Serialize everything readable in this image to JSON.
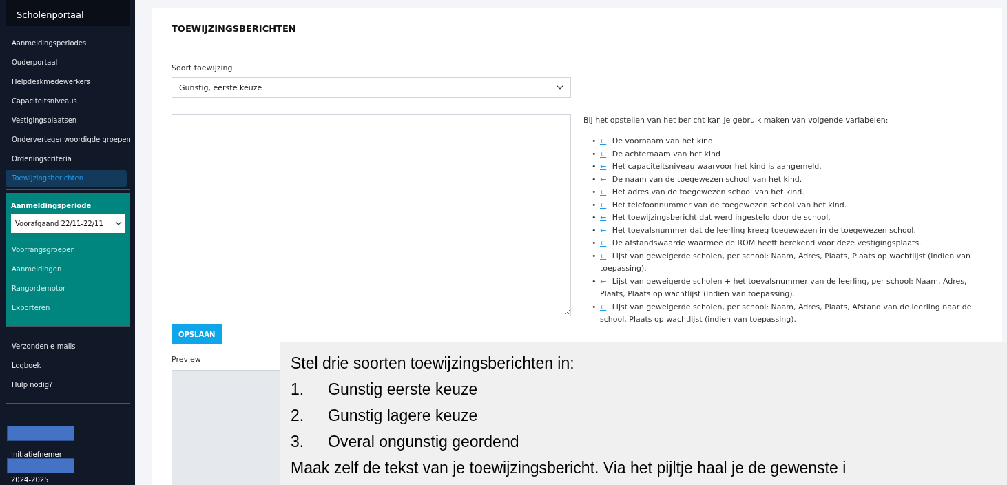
{
  "sidebar": {
    "title": "Scholenportaal",
    "nav": [
      {
        "label": "Aanmeldingsperiodes",
        "selected": false
      },
      {
        "label": "Ouderportaal",
        "selected": false
      },
      {
        "label": "Helpdeskmedewerkers",
        "selected": false
      },
      {
        "label": "Capaciteitsniveaus",
        "selected": false
      },
      {
        "label": "Vestigingsplaatsen",
        "selected": false
      },
      {
        "label": "Ondervertegenwoordigde groepen",
        "selected": false
      },
      {
        "label": "Ordeningscriteria",
        "selected": false
      },
      {
        "label": "Toewijzingsberichten",
        "selected": true
      }
    ],
    "period": {
      "label": "Aanmeldingsperiode",
      "value": "Voorafgaand 22/11-22/11",
      "items": [
        {
          "label": "Voorrangsgroepen",
          "selected": false
        },
        {
          "label": "Aanmeldingen",
          "selected": false
        },
        {
          "label": "Rangordemotor",
          "selected": false
        },
        {
          "label": "Exporteren",
          "selected": false
        }
      ]
    },
    "extra": [
      {
        "label": "Verzonden e-mails",
        "selected": false
      },
      {
        "label": "Logboek",
        "selected": false
      },
      {
        "label": "Hulp nodig?",
        "selected": false
      }
    ],
    "profile": {
      "role": "Initiatiefnemer",
      "year": "2024-2025"
    }
  },
  "card": {
    "title": "TOEWIJZINGSBERICHTEN",
    "type_label": "Soort toewijzing",
    "type_value": "Gunstig, eerste keuze",
    "help_intro": "Bij het opstellen van het bericht kan je gebruik maken van volgende variabelen:",
    "variables": [
      {
        "bullet": "•",
        "insert": "←",
        "text": "De voornaam van het kind"
      },
      {
        "bullet": "•",
        "insert": "←",
        "text": "De achternaam van het kind"
      },
      {
        "bullet": "•",
        "insert": "←",
        "text": "Het capaciteitsniveau waarvoor het kind is aangemeld."
      },
      {
        "bullet": "•",
        "insert": "←",
        "text": "De naam van de toegewezen school van het kind."
      },
      {
        "bullet": "•",
        "insert": "←",
        "text": "Het adres van de toegewezen school van het kind."
      },
      {
        "bullet": "•",
        "insert": "←",
        "text": "Het telefoonnummer van de toegewezen school van het kind."
      },
      {
        "bullet": "•",
        "insert": "←",
        "text": "Het toewijzingsbericht dat werd ingesteld door de school."
      },
      {
        "bullet": "•",
        "insert": "←",
        "text": "Het toevalsnummer dat de leerling kreeg toegewezen in de toegewezen school."
      },
      {
        "bullet": "•",
        "insert": "←",
        "text": "De afstandswaarde waarmee de ROM heeft berekend voor deze vestigingsplaats."
      },
      {
        "bullet": "•",
        "insert": "←",
        "text": "Lijst van geweigerde scholen, per school: Naam, Adres, Plaats, Plaats op wachtlijst (indien van toepassing)."
      },
      {
        "bullet": "•",
        "insert": "←",
        "text": "Lijst van geweigerde scholen + het toevalsnummer van de leerling, per school: Naam, Adres, Plaats, Plaats op wachtlijst (indien van toepassing)."
      },
      {
        "bullet": "•",
        "insert": "←",
        "text": "Lijst van geweigerde scholen, per school: Naam, Adres, Plaats, Afstand van de leerling naar de school, Plaats op wachtlijst (indien van toepassing)."
      }
    ],
    "save": "OPSLAAN",
    "preview_label": "Preview"
  },
  "callout": {
    "heading": "Stel drie soorten toewijzingsberichten in:",
    "steps": [
      {
        "number": "1.",
        "text": "Gunstig eerste keuze"
      },
      {
        "number": "2.",
        "text": "Gunstig lagere keuze"
      },
      {
        "number": "3.",
        "text": "Overal ongunstig geordend"
      }
    ],
    "footer": "Maak zelf de tekst van je toewijzingsbericht. Via het pijltje haal je de gewenste i"
  }
}
